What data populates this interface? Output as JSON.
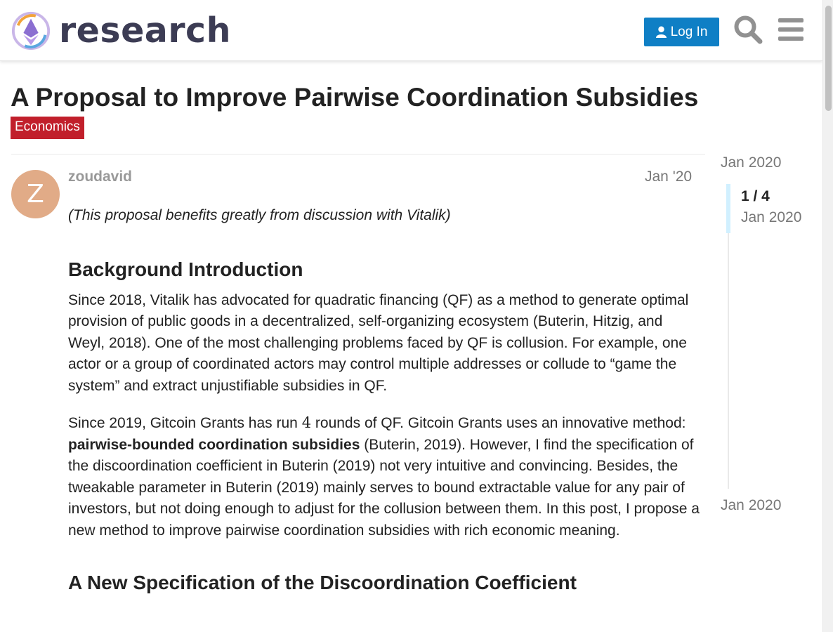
{
  "header": {
    "logo_text": "research",
    "login_label": "Log In",
    "search_icon": "search-icon",
    "menu_icon": "hamburger-menu-icon"
  },
  "topic": {
    "title": "A Proposal to Improve Pairwise Coordination Subsidies",
    "category": "Economics"
  },
  "post": {
    "avatar_letter": "Z",
    "username": "zoudavid",
    "date": "Jan '20",
    "intro": "(This proposal benefits greatly from discussion with Vitalik)",
    "heading1": "Background Introduction",
    "para1": "Since 2018, Vitalik has advocated for quadratic financing (QF) as a method to generate optimal provision of public goods in a decentralized, self-organizing ecosystem (Buterin, Hitzig, and Weyl, 2018). One of the most challenging problems faced by QF is collusion. For example, one actor or a group of coordinated actors may control multiple addresses or collude to “game the system” and extract unjustifiable subsidies in QF.",
    "para2_a": "Since 2019, Gitcoin Grants has run ",
    "para2_math": "4",
    "para2_b": " rounds of QF. Gitcoin Grants uses an innovative method: ",
    "para2_bold": "pairwise-bounded coordination subsidies",
    "para2_c": " (Buterin, 2019). However, I find the specification of the discoordination coefficient in Buterin (2019) not very intuitive and convincing. Besides, the tweakable parameter in Buterin (2019) mainly serves to bound extractable value for any pair of investors, but not doing enough to adjust for the collusion between them. In this post, I propose a new method to improve pairwise coordination subsidies with rich economic meaning.",
    "heading2": "A New Specification of the Discoordination Coefficient"
  },
  "timeline": {
    "start_date": "Jan 2020",
    "position": "1 / 4",
    "position_date": "Jan 2020",
    "end_date": "Jan 2020"
  },
  "colors": {
    "accent": "#0f7fc5",
    "category": "#c11f2b",
    "avatar": "#e1ab87"
  }
}
